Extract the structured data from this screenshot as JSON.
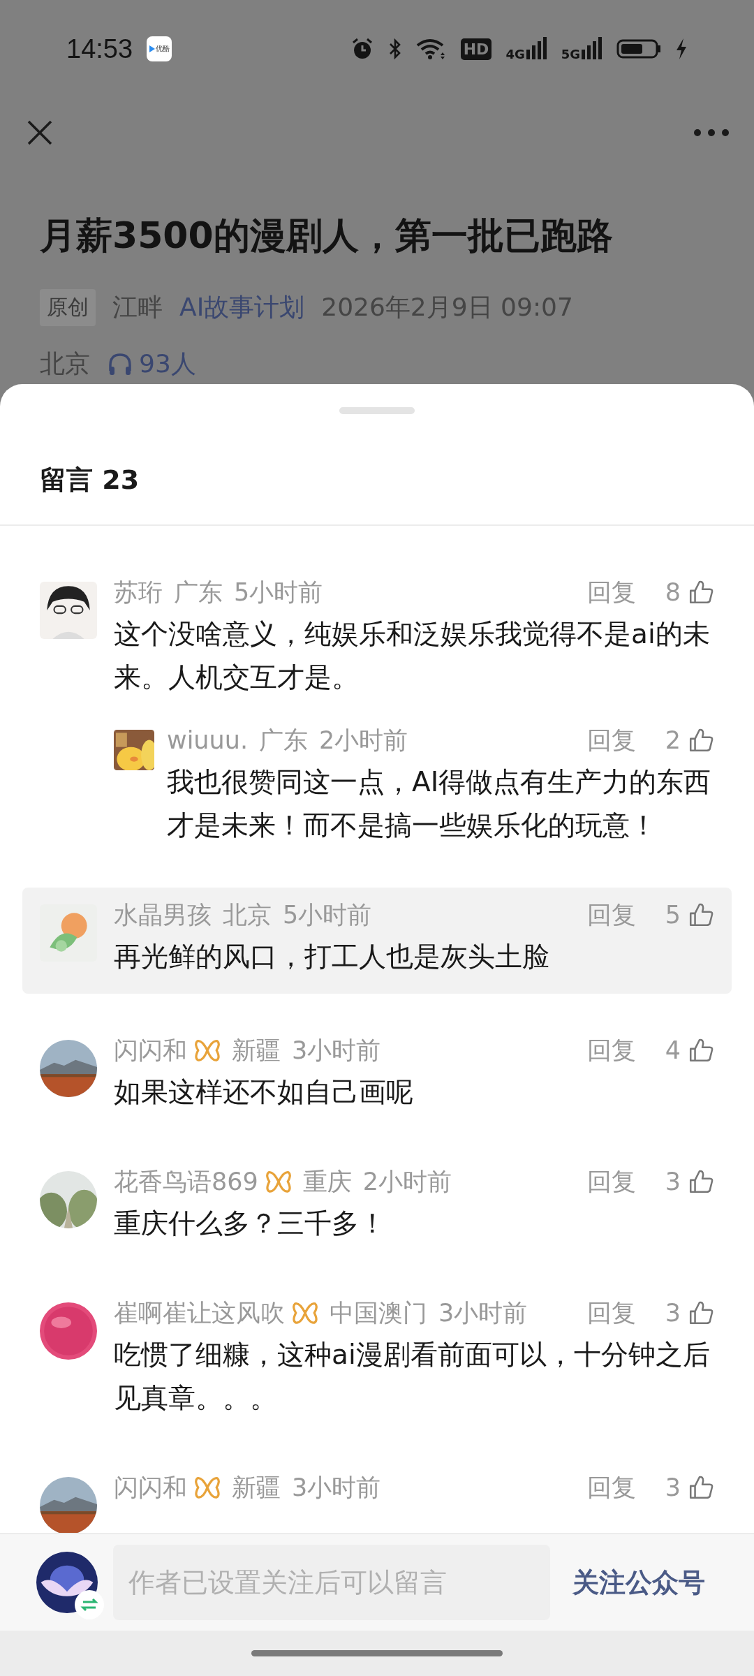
{
  "status_bar": {
    "time": "14:53",
    "app_icon_label": "优酷",
    "hd": "HD",
    "network_1": "4G",
    "network_2": "5G"
  },
  "article": {
    "title": "月薪3500的漫剧人，第一批已跑路",
    "tag": "原创",
    "author": "江畔",
    "account": "AI故事计划",
    "date": "2026年2月9日 09:07",
    "location": "北京",
    "listeners": "93人"
  },
  "comments_sheet": {
    "title": "留言 23",
    "comments": [
      {
        "name": "苏珩",
        "badge": false,
        "region": "广东",
        "time": "5小时前",
        "reply": "回复",
        "likes": "8",
        "text": "这个没啥意义，纯娱乐和泛娱乐我觉得不是ai的未来。人机交互才是。",
        "highlighted": false,
        "children": [
          {
            "name": "wiuuu.",
            "badge": false,
            "region": "广东",
            "time": "2小时前",
            "reply": "回复",
            "likes": "2",
            "text": "我也很赞同这一点，AI得做点有生产力的东西才是未来！而不是搞一些娱乐化的玩意！",
            "highlighted": false
          }
        ]
      },
      {
        "name": "水晶男孩",
        "badge": false,
        "region": "北京",
        "time": "5小时前",
        "reply": "回复",
        "likes": "5",
        "text": "再光鲜的风口，打工人也是灰头土脸",
        "highlighted": true
      },
      {
        "name": "闪闪和",
        "badge": true,
        "region": "新疆",
        "time": "3小时前",
        "reply": "回复",
        "likes": "4",
        "text": "如果这样还不如自己画呢",
        "highlighted": false
      },
      {
        "name": "花香鸟语869",
        "badge": true,
        "region": "重庆",
        "time": "2小时前",
        "reply": "回复",
        "likes": "3",
        "text": "重庆什么多？三千多！",
        "highlighted": false
      },
      {
        "name": "崔啊崔让这风吹",
        "badge": true,
        "region": "中国澳门",
        "time": "3小时前",
        "reply": "回复",
        "likes": "3",
        "text": "吃惯了细糠，这种ai漫剧看前面可以，十分钟之后见真章。。。",
        "highlighted": false
      },
      {
        "name": "闪闪和",
        "badge": true,
        "region": "新疆",
        "time": "3小时前",
        "reply": "回复",
        "likes": "3",
        "highlighted": false
      }
    ]
  },
  "composer": {
    "placeholder": "作者已设置关注后可以留言",
    "follow_button": "关注公众号"
  }
}
